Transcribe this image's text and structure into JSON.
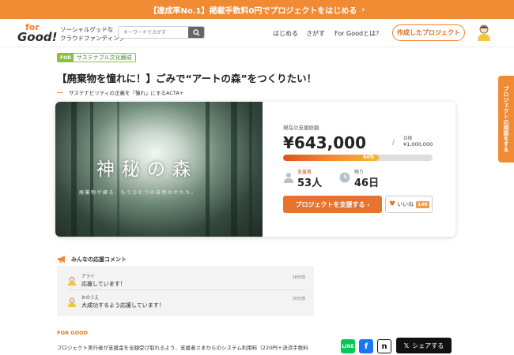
{
  "promo": {
    "text": "【達成率No.1】掲載手数料0円でプロジェクトをはじめる",
    "chevron": "›"
  },
  "header": {
    "logo_top": "for",
    "logo_bottom": "Good!",
    "tagline_line1": "ソーシャルグッドな",
    "tagline_line2": "クラウドファンディング",
    "search_placeholder": "キーワードでさがす",
    "nav": [
      "はじめる",
      "さがす",
      "For Goodとは？"
    ],
    "cta": "作成したプロジェクト"
  },
  "project": {
    "category_tag": "FOR",
    "category": "サステナブル文化醸成",
    "title": "【廃棄物を憧れに！】ごみで“アートの森”をつくりたい！",
    "organizer": "サステナビリティの正義を「憧れ」にするACTA+",
    "hero_title": "神秘の森",
    "hero_subtitle": "廃棄物が蘇る、もうひとつの自然のかたち。"
  },
  "funding": {
    "current_label": "現在の支援総額",
    "amount": "¥643,000",
    "slash": "/",
    "goal_label": "目標",
    "goal": "¥1,000,000",
    "percent_label": "64％",
    "progress": 0.64,
    "supporters_label": "支援者",
    "supporters": "53人",
    "remaining_label": "残り",
    "remaining": "46日",
    "support_button": "プロジェクトを支援する ›",
    "like_label": "いいね",
    "like_count": "140"
  },
  "side_tab": "プロジェクトの相談をする",
  "comments": {
    "heading": "みんなの応援コメント",
    "items": [
      {
        "name": "アライ",
        "text": "応援しています！",
        "time": "28分前"
      },
      {
        "name": "おのうえ",
        "text": "大成功するよう応援しています！",
        "time": "30分前"
      }
    ]
  },
  "footer": {
    "brand": "FOR GOOD",
    "description": "プロジェクト実行者が支援金を全額受け取れるよう、支援者さまからのシステム利用料（220円＋決済手数料",
    "share_label": "シェアする"
  },
  "colors": {
    "accent": "#f08a33",
    "green": "#8bbf3f"
  }
}
